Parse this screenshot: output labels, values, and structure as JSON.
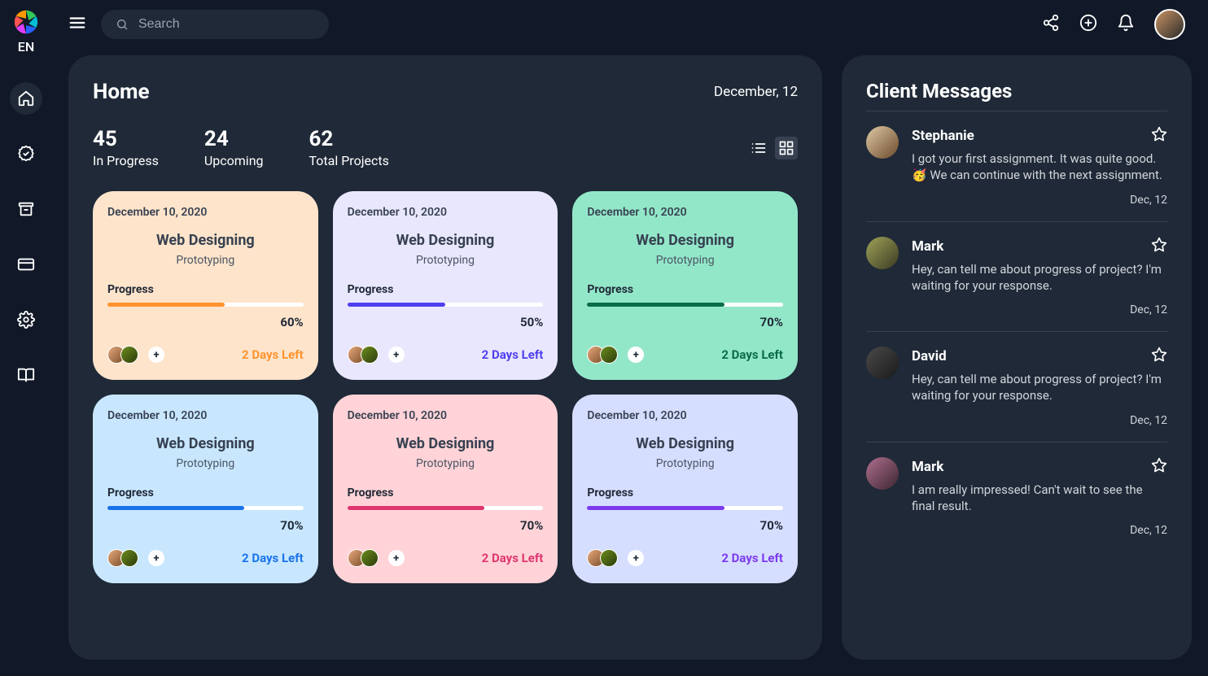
{
  "sidebar": {
    "lang": "EN"
  },
  "topbar": {
    "search_placeholder": "Search"
  },
  "home": {
    "title": "Home",
    "date": "December, 12",
    "stats": [
      {
        "value": "45",
        "label": "In Progress"
      },
      {
        "value": "24",
        "label": "Upcoming"
      },
      {
        "value": "62",
        "label": "Total Projects"
      }
    ],
    "progress_word": "Progress"
  },
  "cards": [
    {
      "date": "December 10, 2020",
      "title": "Web Designing",
      "subtitle": "Prototyping",
      "pct": 60,
      "pct_label": "60%",
      "days_left": "2 Days Left",
      "bg": "#fee4cb",
      "accent": "#ff942e",
      "days_color": "#ff942e",
      "avatar1": "linear-gradient(135deg,#e8a87c,#7a4f2a)",
      "avatar2": "linear-gradient(135deg,#6b8e1f,#2d3a0a)"
    },
    {
      "date": "December 10, 2020",
      "title": "Web Designing",
      "subtitle": "Prototyping",
      "pct": 50,
      "pct_label": "50%",
      "days_left": "2 Days Left",
      "bg": "#e9e7fd",
      "accent": "#4f3ff0",
      "days_color": "#4f3ff0",
      "avatar1": "linear-gradient(135deg,#e8a87c,#7a4f2a)",
      "avatar2": "linear-gradient(135deg,#6b8e1f,#2d3a0a)"
    },
    {
      "date": "December 10, 2020",
      "title": "Web Designing",
      "subtitle": "Prototyping",
      "pct": 70,
      "pct_label": "70%",
      "days_left": "2 Days Left",
      "bg": "#93e7c9",
      "accent": "#096c47",
      "days_color": "#096c47",
      "avatar1": "linear-gradient(135deg,#e8a87c,#7a4f2a)",
      "avatar2": "linear-gradient(135deg,#6b8e1f,#2d3a0a)"
    },
    {
      "date": "December 10, 2020",
      "title": "Web Designing",
      "subtitle": "Prototyping",
      "pct": 70,
      "pct_label": "70%",
      "days_left": "2 Days Left",
      "bg": "#c8e7ff",
      "accent": "#1a73e8",
      "days_color": "#1a73e8",
      "avatar1": "linear-gradient(135deg,#e8a87c,#7a4f2a)",
      "avatar2": "linear-gradient(135deg,#6b8e1f,#2d3a0a)"
    },
    {
      "date": "December 10, 2020",
      "title": "Web Designing",
      "subtitle": "Prototyping",
      "pct": 70,
      "pct_label": "70%",
      "days_left": "2 Days Left",
      "bg": "#ffd3d7",
      "accent": "#df3670",
      "days_color": "#df3670",
      "avatar1": "linear-gradient(135deg,#e8a87c,#7a4f2a)",
      "avatar2": "linear-gradient(135deg,#6b8e1f,#2d3a0a)"
    },
    {
      "date": "December 10, 2020",
      "title": "Web Designing",
      "subtitle": "Prototyping",
      "pct": 70,
      "pct_label": "70%",
      "days_left": "2 Days Left",
      "bg": "#d5deff",
      "accent": "#7c3aed",
      "days_color": "#7c3aed",
      "avatar1": "linear-gradient(135deg,#e8a87c,#7a4f2a)",
      "avatar2": "linear-gradient(135deg,#6b8e1f,#2d3a0a)"
    }
  ],
  "messages": {
    "title": "Client Messages",
    "items": [
      {
        "name": "Stephanie",
        "text": "I got your first assignment. It was quite good. 🥳 We can continue with the next assignment.",
        "date": "Dec, 12",
        "avatar": "linear-gradient(135deg,#e0c9a6,#6b4a2a)"
      },
      {
        "name": "Mark",
        "text": "Hey, can tell me about progress of project? I'm waiting for your response.",
        "date": "Dec, 12",
        "avatar": "linear-gradient(135deg,#9fa35a,#3a3a20)"
      },
      {
        "name": "David",
        "text": "Hey, can tell me about progress of project? I'm waiting for your response.",
        "date": "Dec, 12",
        "avatar": "linear-gradient(135deg,#4a4a4a,#1a1a1a)"
      },
      {
        "name": "Mark",
        "text": "I am really impressed! Can't wait to see the final result.",
        "date": "Dec, 12",
        "avatar": "linear-gradient(135deg,#b06f8e,#3a2530)"
      }
    ]
  }
}
